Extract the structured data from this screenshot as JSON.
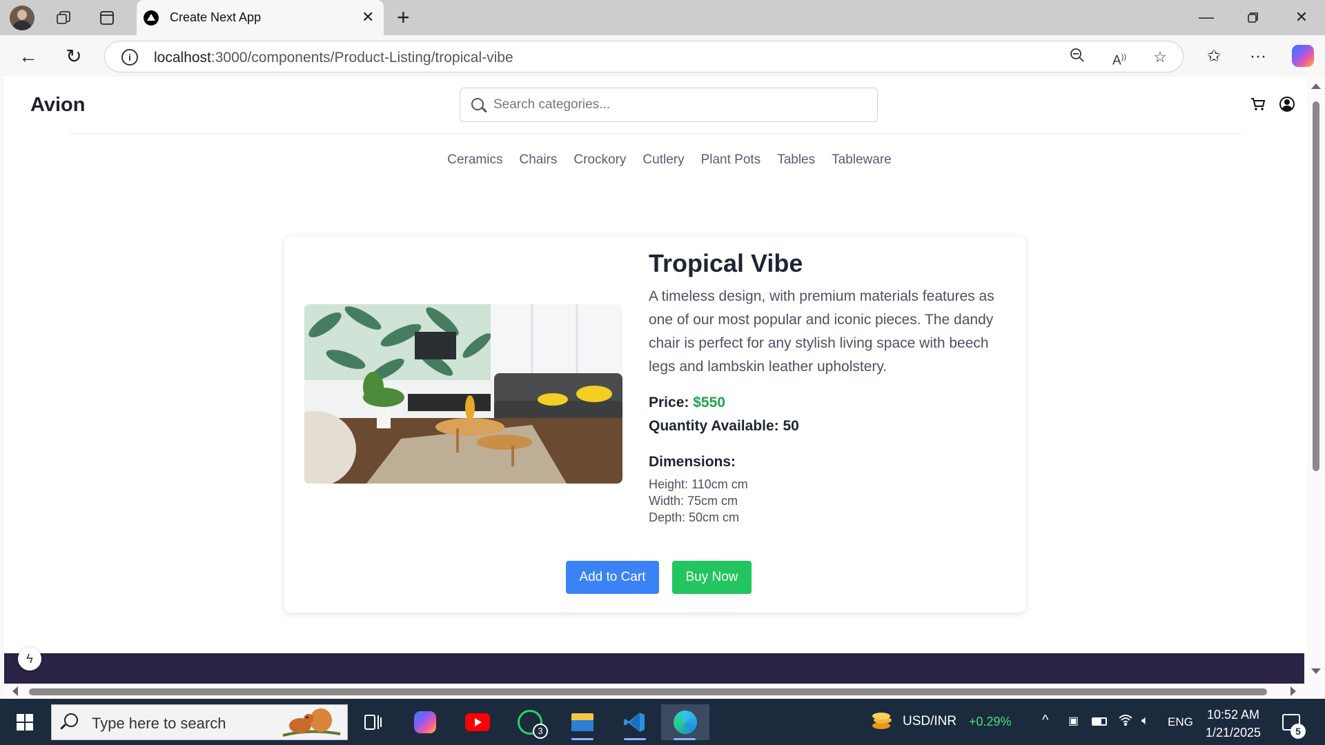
{
  "browser": {
    "tab_title": "Create Next App",
    "url_host": "localhost",
    "url_path": ":3000/components/Product-Listing/tropical-vibe"
  },
  "site": {
    "logo": "Avion",
    "search_placeholder": "Search categories...",
    "categories": [
      "Ceramics",
      "Chairs",
      "Crockory",
      "Cutlery",
      "Plant Pots",
      "Tables",
      "Tableware"
    ]
  },
  "product": {
    "title": "Tropical Vibe",
    "description": "A timeless design, with premium materials features as one of our most popular and iconic pieces. The dandy chair is perfect for any stylish living space with beech legs and lambskin leather upholstery.",
    "price_label": "Price:",
    "price_value": "$550",
    "quantity_label": "Quantity Available: 50",
    "dimensions_title": "Dimensions:",
    "height": "Height: 110cm cm",
    "width": "Width: 75cm cm",
    "depth": "Depth: 50cm cm",
    "add_to_cart": "Add to Cart",
    "buy_now": "Buy Now"
  },
  "taskbar": {
    "search_placeholder": "Type here to search",
    "whatsapp_badge": "3",
    "ticker_label": "USD/INR",
    "ticker_change": "+0.29%",
    "language": "ENG",
    "time": "10:52 AM",
    "date": "1/21/2025",
    "notifications_count": "5"
  },
  "colors": {
    "accent_blue": "#3b82f6",
    "accent_green": "#22c55e",
    "price_green": "#1ea54c",
    "footer": "#2a2346",
    "taskbar": "#1c2a3d",
    "ticker_positive": "#4ade80"
  }
}
